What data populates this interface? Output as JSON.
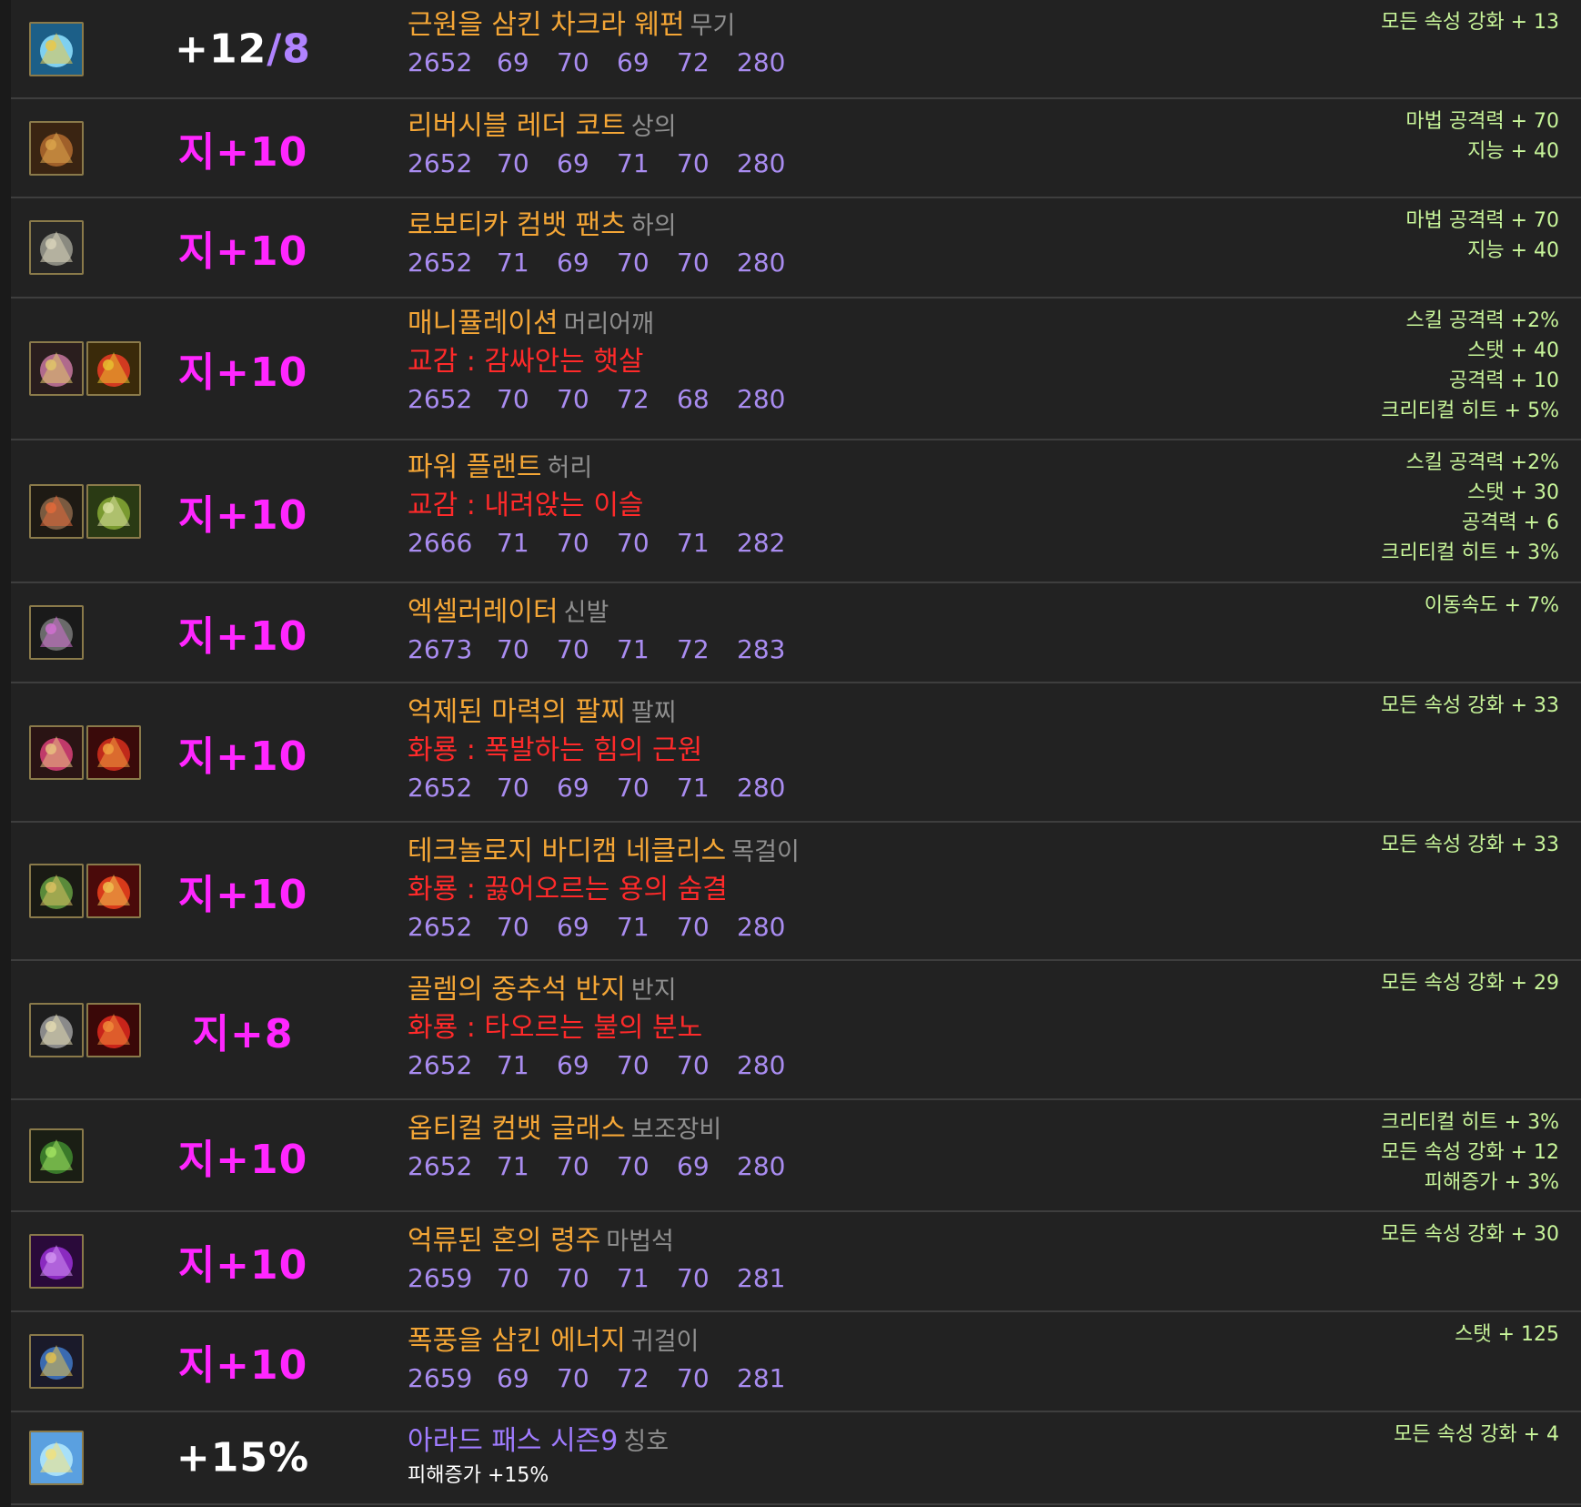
{
  "items": [
    {
      "enh_parts": [
        {
          "t": "+12",
          "c": "w"
        },
        {
          "t": "/8",
          "c": "s"
        }
      ],
      "name": "근원을 삼킨 차크라 웨펀",
      "slot": "무기",
      "fusion": "",
      "stats": [
        "2652",
        "69",
        "70",
        "69",
        "72",
        "280"
      ],
      "extra": "",
      "options": [
        "모든 속성 강화 + 13"
      ],
      "icons": [
        "chakra-weapon-icon"
      ]
    },
    {
      "enh_parts": [
        {
          "t": "지+10",
          "c": "p"
        }
      ],
      "name": "리버시블 레더 코트",
      "slot": "상의",
      "fusion": "",
      "stats": [
        "2652",
        "70",
        "69",
        "71",
        "70",
        "280"
      ],
      "extra": "",
      "options": [
        "마법 공격력 + 70",
        "지능 + 40"
      ],
      "icons": [
        "leather-coat-icon"
      ]
    },
    {
      "enh_parts": [
        {
          "t": "지+10",
          "c": "p"
        }
      ],
      "name": "로보티카 컴뱃 팬츠",
      "slot": "하의",
      "fusion": "",
      "stats": [
        "2652",
        "71",
        "69",
        "70",
        "70",
        "280"
      ],
      "extra": "",
      "options": [
        "마법 공격력 + 70",
        "지능 + 40"
      ],
      "icons": [
        "combat-pants-icon"
      ]
    },
    {
      "enh_parts": [
        {
          "t": "지+10",
          "c": "p"
        }
      ],
      "name": "매니퓰레이션",
      "slot": "머리어깨",
      "fusion": "교감 : 감싸안는 햇살",
      "stats": [
        "2652",
        "70",
        "70",
        "72",
        "68",
        "280"
      ],
      "extra": "",
      "options": [
        "스킬 공격력 +2%",
        "스탯 + 40",
        "공격력 + 10",
        "크리티컬 히트 + 5%"
      ],
      "icons": [
        "manipulation-icon",
        "sunlight-fusion-icon"
      ]
    },
    {
      "enh_parts": [
        {
          "t": "지+10",
          "c": "p"
        }
      ],
      "name": "파워 플랜트",
      "slot": "허리",
      "fusion": "교감 : 내려앉는 이슬",
      "stats": [
        "2666",
        "71",
        "70",
        "70",
        "71",
        "282"
      ],
      "extra": "",
      "options": [
        "스킬 공격력 +2%",
        "스탯 + 30",
        "공격력 + 6",
        "크리티컬 히트 + 3%"
      ],
      "icons": [
        "power-plant-icon",
        "dew-fusion-icon"
      ]
    },
    {
      "enh_parts": [
        {
          "t": "지+10",
          "c": "p"
        }
      ],
      "name": "엑셀러레이터",
      "slot": "신발",
      "fusion": "",
      "stats": [
        "2673",
        "70",
        "70",
        "71",
        "72",
        "283"
      ],
      "extra": "",
      "options": [
        "이동속도 + 7%"
      ],
      "icons": [
        "accelerator-icon"
      ]
    },
    {
      "enh_parts": [
        {
          "t": "지+10",
          "c": "p"
        }
      ],
      "name": "억제된 마력의 팔찌",
      "slot": "팔찌",
      "fusion": "화룡 : 폭발하는 힘의 근원",
      "stats": [
        "2652",
        "70",
        "69",
        "70",
        "71",
        "280"
      ],
      "extra": "",
      "options": [
        "모든 속성 강화 + 33"
      ],
      "icons": [
        "bracelet-icon",
        "dragon-fusion-icon"
      ]
    },
    {
      "enh_parts": [
        {
          "t": "지+10",
          "c": "p"
        }
      ],
      "name": "테크놀로지 바디캠 네클리스",
      "slot": "목걸이",
      "fusion": "화룡 : 끓어오르는 용의 숨결",
      "stats": [
        "2652",
        "70",
        "69",
        "71",
        "70",
        "280"
      ],
      "extra": "",
      "options": [
        "모든 속성 강화 + 33"
      ],
      "icons": [
        "necklace-icon",
        "dragon-breath-fusion-icon"
      ]
    },
    {
      "enh_parts": [
        {
          "t": "지+8",
          "c": "p"
        }
      ],
      "name": "골렘의 중추석 반지",
      "slot": "반지",
      "fusion": "화룡 : 타오르는 불의 분노",
      "stats": [
        "2652",
        "71",
        "69",
        "70",
        "70",
        "280"
      ],
      "extra": "",
      "options": [
        "모든 속성 강화 + 29"
      ],
      "icons": [
        "ring-icon",
        "fire-ring-fusion-icon"
      ]
    },
    {
      "enh_parts": [
        {
          "t": "지+10",
          "c": "p"
        }
      ],
      "name": "옵티컬 컴뱃 글래스",
      "slot": "보조장비",
      "fusion": "",
      "stats": [
        "2652",
        "71",
        "70",
        "70",
        "69",
        "280"
      ],
      "extra": "",
      "options": [
        "크리티컬 히트 + 3%",
        "모든 속성 강화 + 12",
        "피해증가 + 3%"
      ],
      "icons": [
        "combat-glasses-icon"
      ]
    },
    {
      "enh_parts": [
        {
          "t": "지+10",
          "c": "p"
        }
      ],
      "name": "억류된 혼의 령주",
      "slot": "마법석",
      "fusion": "",
      "stats": [
        "2659",
        "70",
        "70",
        "71",
        "70",
        "281"
      ],
      "extra": "",
      "options": [
        "모든 속성 강화 + 30"
      ],
      "icons": [
        "soul-orb-icon"
      ]
    },
    {
      "enh_parts": [
        {
          "t": "지+10",
          "c": "p"
        }
      ],
      "name": "폭풍을 삼킨 에너지",
      "slot": "귀걸이",
      "fusion": "",
      "stats": [
        "2659",
        "69",
        "70",
        "72",
        "70",
        "281"
      ],
      "extra": "",
      "options": [
        "스탯 + 125"
      ],
      "icons": [
        "earring-icon"
      ]
    },
    {
      "enh_parts": [
        {
          "t": "+15%",
          "c": "w"
        }
      ],
      "name": "아라드 패스 시즌9",
      "slot": "칭호",
      "fusion": "",
      "stats": [],
      "extra": "피해증가 +15%",
      "options": [
        "모든 속성 강화 + 4"
      ],
      "icons": [
        "title-icon"
      ],
      "is_title": true
    }
  ],
  "colors": {
    "name": "#f4a636",
    "title_name": "#a07cff",
    "slot": "#8f8f8f",
    "fusion": "#ff2a2a",
    "stats": "#a98cf0",
    "option": "#c8f59a",
    "enhance_pink": "#ff26ff",
    "background": "#222222",
    "divider": "#3e3e3e"
  }
}
